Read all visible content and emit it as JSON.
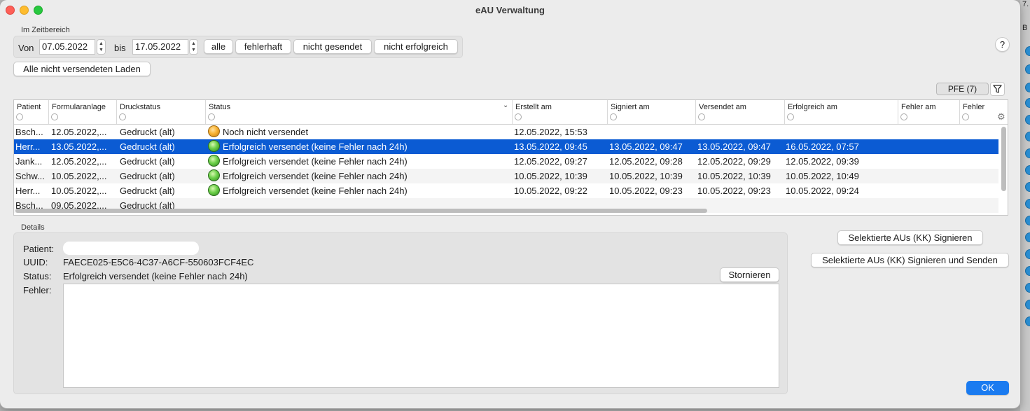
{
  "window": {
    "title": "eAU Verwaltung"
  },
  "zeitbereich": {
    "group_label": "Im Zeitbereich",
    "von_label": "Von",
    "von_value": "07.05.2022",
    "bis_label": "bis",
    "bis_value": "17.05.2022",
    "buttons": [
      "alle",
      "fehlerhaft",
      "nicht gesendet",
      "nicht erfolgreich"
    ]
  },
  "load_button": "Alle nicht versendeten Laden",
  "help_label": "?",
  "pfe_label": "PFE (7)",
  "table": {
    "headers": [
      "Patient",
      "Formularanlage",
      "Druckstatus",
      "Status",
      "Erstellt am",
      "Signiert am",
      "Versendet am",
      "Erfolgreich am",
      "Fehler am",
      "Fehler"
    ],
    "rows": [
      {
        "patient": "Bsch...",
        "formular": "12.05.2022,...",
        "druck": "Gedruckt (alt)",
        "status": "Noch nicht versendet",
        "status_color": "orange",
        "erstellt": "12.05.2022, 15:53",
        "signiert": "",
        "versendet": "",
        "erfolgreich": ""
      },
      {
        "patient": "Herr...",
        "formular": "13.05.2022,...",
        "druck": "Gedruckt (alt)",
        "status": "Erfolgreich versendet (keine Fehler nach 24h)",
        "status_color": "green",
        "erstellt": "13.05.2022, 09:45",
        "signiert": "13.05.2022, 09:47",
        "versendet": "13.05.2022, 09:47",
        "erfolgreich": "16.05.2022, 07:57"
      },
      {
        "patient": "Jank...",
        "formular": "12.05.2022,...",
        "druck": "Gedruckt (alt)",
        "status": "Erfolgreich versendet (keine Fehler nach 24h)",
        "status_color": "green",
        "erstellt": "12.05.2022, 09:27",
        "signiert": "12.05.2022, 09:28",
        "versendet": "12.05.2022, 09:29",
        "erfolgreich": "12.05.2022, 09:39"
      },
      {
        "patient": "Schw...",
        "formular": "10.05.2022,...",
        "druck": "Gedruckt (alt)",
        "status": "Erfolgreich versendet (keine Fehler nach 24h)",
        "status_color": "green",
        "erstellt": "10.05.2022, 10:39",
        "signiert": "10.05.2022, 10:39",
        "versendet": "10.05.2022, 10:39",
        "erfolgreich": "10.05.2022, 10:49"
      },
      {
        "patient": "Herr...",
        "formular": "10.05.2022,...",
        "druck": "Gedruckt (alt)",
        "status": "Erfolgreich versendet (keine Fehler nach 24h)",
        "status_color": "green",
        "erstellt": "10.05.2022, 09:22",
        "signiert": "10.05.2022, 09:23",
        "versendet": "10.05.2022, 09:23",
        "erfolgreich": "10.05.2022, 09:24"
      },
      {
        "patient": "Bsch...",
        "formular": "09.05.2022,...",
        "druck": "Gedruckt (alt)",
        "status": "",
        "status_color": "",
        "erstellt": "",
        "signiert": "",
        "versendet": "",
        "erfolgreich": ""
      }
    ],
    "selected_row": 1
  },
  "details": {
    "group_label": "Details",
    "patient_label": "Patient:",
    "patient_value": "",
    "uuid_label": "UUID:",
    "uuid_value": "FAECE025-E5C6-4C37-A6CF-550603FCF4EC",
    "status_label": "Status:",
    "status_value": "Erfolgreich versendet (keine Fehler nach 24h)",
    "fehler_label": "Fehler:",
    "fehler_value": "",
    "stornieren": "Stornieren"
  },
  "actions": {
    "sign": "Selektierte AUs (KK) Signieren",
    "sign_send": "Selektierte AUs (KK) Signieren und Senden",
    "ok": "OK"
  },
  "colors": {
    "selection": "#0b5bd3",
    "ok_button": "#1a7bf0",
    "status_pending": "orange",
    "status_success": "green"
  }
}
